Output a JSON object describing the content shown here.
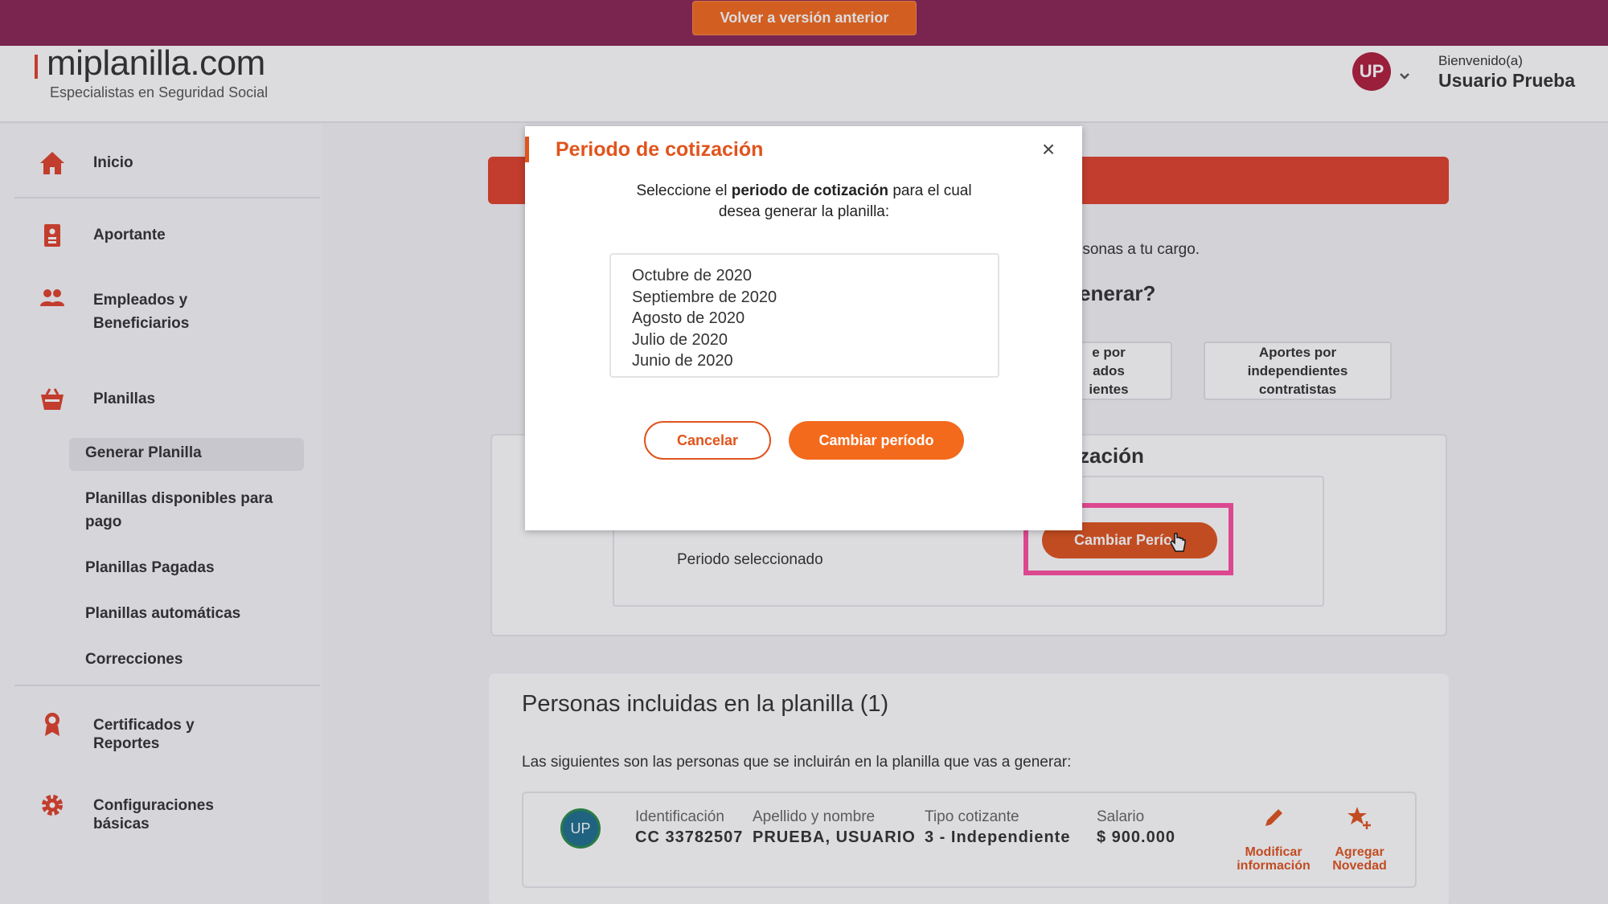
{
  "banner": {
    "back_label": "Volver a versión anterior"
  },
  "header": {
    "logo_text": "miplanilla.com",
    "logo_sub": "Especialistas en Seguridad Social",
    "avatar_initials": "UP",
    "welcome": "Bienvenido(a)",
    "username": "Usuario Prueba"
  },
  "sidebar": {
    "items": [
      {
        "label": "Inicio",
        "icon": "home-icon"
      },
      {
        "label": "Aportante",
        "icon": "id-card-icon"
      },
      {
        "label_line1": "Empleados y",
        "label_line2": "Beneficiarios",
        "icon": "people-icon"
      },
      {
        "label": "Planillas",
        "icon": "basket-icon"
      },
      {
        "label_line1": "Certificados y",
        "label_line2": "Reportes",
        "icon": "award-icon"
      },
      {
        "label_line1": "Configuraciones",
        "label_line2": "básicas",
        "icon": "gear-icon"
      }
    ],
    "planillas_sub": [
      {
        "label": "Generar Planilla"
      },
      {
        "label_line1": "Planillas disponibles para",
        "label_line2": "pago"
      },
      {
        "label": "Planillas Pagadas"
      },
      {
        "label": "Planillas automáticas"
      },
      {
        "label": "Correcciones"
      }
    ]
  },
  "main": {
    "info_partial": "rsonas a tu cargo.",
    "question_partial": "enerar?",
    "options": [
      {
        "line1": "e por",
        "line2": "ados",
        "line3": "ientes"
      },
      {
        "line1": "Aportes por",
        "line2": "independientes",
        "line3": "contratistas"
      }
    ],
    "section_partial": "zación",
    "period_label": "Periodo seleccionado",
    "change_period_label": "Cambiar Perío",
    "persons": {
      "title": "Personas incluidas en la planilla (1)",
      "subtitle": "Las siguientes son las personas que se incluirán en la planilla que vas a generar:",
      "row": {
        "avatar": "UP",
        "id_label": "Identificación",
        "id_value": "CC 33782507",
        "name_label": "Apellido y nombre",
        "name_value": "PRUEBA, USUARIO",
        "type_label": "Tipo cotizante",
        "type_value": "3 - Independiente",
        "salary_label": "Salario",
        "salary_value": "$ 900.000",
        "action_edit_line1": "Modificar",
        "action_edit_line2": "información",
        "action_add_line1": "Agregar",
        "action_add_line2": "Novedad"
      }
    }
  },
  "modal": {
    "title": "Periodo de cotización",
    "close": "×",
    "desc_a": "Seleccione el ",
    "desc_b": "periodo de cotización",
    "desc_c": " para el cual",
    "desc_d": "desea generar la planilla:",
    "periods": [
      "Octubre de 2020",
      "Septiembre de 2020",
      "Agosto de 2020",
      "Julio de 2020",
      "Junio de 2020"
    ],
    "cancel": "Cancelar",
    "confirm": "Cambiar período"
  },
  "colors": {
    "brand": "#8a2654",
    "accent": "#f36a1d",
    "danger": "#e0422b",
    "highlight": "#ff4fa0"
  }
}
